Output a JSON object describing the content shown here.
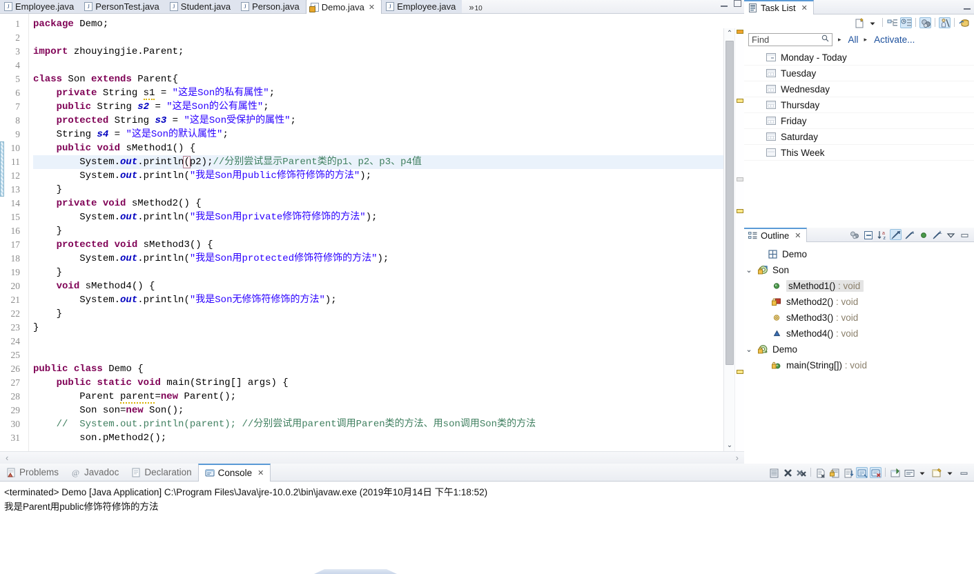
{
  "editor": {
    "tabs": [
      {
        "label": "Employee.java",
        "active": false,
        "warn": false
      },
      {
        "label": "PersonTest.java",
        "active": false,
        "warn": false
      },
      {
        "label": "Student.java",
        "active": false,
        "warn": false
      },
      {
        "label": "Person.java",
        "active": false,
        "warn": false
      },
      {
        "label": "Demo.java",
        "active": true,
        "warn": true
      },
      {
        "label": "Employee.java",
        "active": false,
        "warn": false
      }
    ],
    "overflow_chevron": "»",
    "overflow_count": "10",
    "close_glyph": "✕",
    "hscroll_left": "‹",
    "hscroll_right": "›",
    "scroll_up": "⌃",
    "scroll_down": "⌄",
    "lines": [
      {
        "n": "1",
        "tokens": [
          {
            "t": "package",
            "c": "kw"
          },
          {
            "t": " Demo;",
            "c": "plain"
          }
        ]
      },
      {
        "n": "2",
        "tokens": []
      },
      {
        "n": "3",
        "tokens": [
          {
            "t": "import",
            "c": "kw"
          },
          {
            "t": " zhouyingjie.Parent;",
            "c": "plain"
          }
        ]
      },
      {
        "n": "4",
        "tokens": []
      },
      {
        "n": "5",
        "tokens": [
          {
            "t": "class",
            "c": "kw"
          },
          {
            "t": " Son ",
            "c": "plain"
          },
          {
            "t": "extends",
            "c": "kw"
          },
          {
            "t": " Parent{",
            "c": "plain"
          }
        ]
      },
      {
        "n": "6",
        "warn": true,
        "tokens": [
          {
            "t": "    ",
            "c": "plain"
          },
          {
            "t": "private",
            "c": "kw"
          },
          {
            "t": " String ",
            "c": "plain"
          },
          {
            "t": "s1",
            "c": "plain",
            "sq": true
          },
          {
            "t": " = ",
            "c": "plain"
          },
          {
            "t": "\"这是Son的私有属性\"",
            "c": "str"
          },
          {
            "t": ";",
            "c": "plain"
          }
        ]
      },
      {
        "n": "7",
        "tokens": [
          {
            "t": "    ",
            "c": "plain"
          },
          {
            "t": "public",
            "c": "kw"
          },
          {
            "t": " String ",
            "c": "plain"
          },
          {
            "t": "s2",
            "c": "fld"
          },
          {
            "t": " = ",
            "c": "plain"
          },
          {
            "t": "\"这是Son的公有属性\"",
            "c": "str"
          },
          {
            "t": ";",
            "c": "plain"
          }
        ]
      },
      {
        "n": "8",
        "tokens": [
          {
            "t": "    ",
            "c": "plain"
          },
          {
            "t": "protected",
            "c": "kw"
          },
          {
            "t": " String ",
            "c": "plain"
          },
          {
            "t": "s3",
            "c": "fld"
          },
          {
            "t": " = ",
            "c": "plain"
          },
          {
            "t": "\"这是Son受保护的属性\"",
            "c": "str"
          },
          {
            "t": ";",
            "c": "plain"
          }
        ]
      },
      {
        "n": "9",
        "tokens": [
          {
            "t": "    String ",
            "c": "plain"
          },
          {
            "t": "s4",
            "c": "fld"
          },
          {
            "t": " = ",
            "c": "plain"
          },
          {
            "t": "\"这是Son的默认属性\"",
            "c": "str"
          },
          {
            "t": ";",
            "c": "plain"
          }
        ]
      },
      {
        "n": "10",
        "fold": true,
        "tokens": [
          {
            "t": "    ",
            "c": "plain"
          },
          {
            "t": "public",
            "c": "kw"
          },
          {
            "t": " ",
            "c": "plain"
          },
          {
            "t": "void",
            "c": "kw"
          },
          {
            "t": " sMethod1() {",
            "c": "plain"
          }
        ]
      },
      {
        "n": "11",
        "current": true,
        "tokens": [
          {
            "t": "        System.",
            "c": "plain"
          },
          {
            "t": "out",
            "c": "fld"
          },
          {
            "t": ".println",
            "c": "plain"
          },
          {
            "t": "(",
            "c": "plain",
            "brkt": true
          },
          {
            "t": "p2);",
            "c": "plain"
          },
          {
            "t": "//分别尝试显示Parent类的p1、p2、p3、p4值",
            "c": "cmt"
          }
        ]
      },
      {
        "n": "12",
        "tokens": [
          {
            "t": "        System.",
            "c": "plain"
          },
          {
            "t": "out",
            "c": "fld"
          },
          {
            "t": ".println(",
            "c": "plain"
          },
          {
            "t": "\"我是Son用public修饰符修饰的方法\"",
            "c": "str"
          },
          {
            "t": ");",
            "c": "plain"
          }
        ]
      },
      {
        "n": "13",
        "tokens": [
          {
            "t": "    }",
            "c": "plain"
          }
        ]
      },
      {
        "n": "14",
        "warn": true,
        "fold": true,
        "tokens": [
          {
            "t": "    ",
            "c": "plain"
          },
          {
            "t": "private",
            "c": "kw"
          },
          {
            "t": " ",
            "c": "plain"
          },
          {
            "t": "void",
            "c": "kw"
          },
          {
            "t": " sMethod2() {",
            "c": "plain"
          }
        ]
      },
      {
        "n": "15",
        "tokens": [
          {
            "t": "        System.",
            "c": "plain"
          },
          {
            "t": "out",
            "c": "fld"
          },
          {
            "t": ".println(",
            "c": "plain"
          },
          {
            "t": "\"我是Son用private修饰符修饰的方法\"",
            "c": "str"
          },
          {
            "t": ");",
            "c": "plain"
          }
        ]
      },
      {
        "n": "16",
        "tokens": [
          {
            "t": "    }",
            "c": "plain"
          }
        ]
      },
      {
        "n": "17",
        "fold": true,
        "tokens": [
          {
            "t": "    ",
            "c": "plain"
          },
          {
            "t": "protected",
            "c": "kw"
          },
          {
            "t": " ",
            "c": "plain"
          },
          {
            "t": "void",
            "c": "kw"
          },
          {
            "t": " sMethod3() {",
            "c": "plain"
          }
        ]
      },
      {
        "n": "18",
        "tokens": [
          {
            "t": "        System.",
            "c": "plain"
          },
          {
            "t": "out",
            "c": "fld"
          },
          {
            "t": ".println(",
            "c": "plain"
          },
          {
            "t": "\"我是Son用protected修饰符修饰的方法\"",
            "c": "str"
          },
          {
            "t": ");",
            "c": "plain"
          }
        ]
      },
      {
        "n": "19",
        "tokens": [
          {
            "t": "    }",
            "c": "plain"
          }
        ]
      },
      {
        "n": "20",
        "fold": true,
        "tokens": [
          {
            "t": "    ",
            "c": "plain"
          },
          {
            "t": "void",
            "c": "kw"
          },
          {
            "t": " sMethod4() {",
            "c": "plain"
          }
        ]
      },
      {
        "n": "21",
        "tokens": [
          {
            "t": "        System.",
            "c": "plain"
          },
          {
            "t": "out",
            "c": "fld"
          },
          {
            "t": ".println(",
            "c": "plain"
          },
          {
            "t": "\"我是Son无修饰符修饰的方法\"",
            "c": "str"
          },
          {
            "t": ");",
            "c": "plain"
          }
        ]
      },
      {
        "n": "22",
        "tokens": [
          {
            "t": "    }",
            "c": "plain"
          }
        ]
      },
      {
        "n": "23",
        "tokens": [
          {
            "t": "}",
            "c": "plain"
          }
        ]
      },
      {
        "n": "24",
        "tokens": []
      },
      {
        "n": "25",
        "tokens": []
      },
      {
        "n": "26",
        "tokens": [
          {
            "t": "public",
            "c": "kw"
          },
          {
            "t": " ",
            "c": "plain"
          },
          {
            "t": "class",
            "c": "kw"
          },
          {
            "t": " Demo {",
            "c": "plain"
          }
        ]
      },
      {
        "n": "27",
        "fold": true,
        "tokens": [
          {
            "t": "    ",
            "c": "plain"
          },
          {
            "t": "public",
            "c": "kw"
          },
          {
            "t": " ",
            "c": "plain"
          },
          {
            "t": "static",
            "c": "kw"
          },
          {
            "t": " ",
            "c": "plain"
          },
          {
            "t": "void",
            "c": "kw"
          },
          {
            "t": " main(String[] args) {",
            "c": "plain"
          }
        ]
      },
      {
        "n": "28",
        "warn": true,
        "tokens": [
          {
            "t": "        Parent ",
            "c": "plain"
          },
          {
            "t": "parent",
            "c": "plain",
            "sq": true
          },
          {
            "t": "=",
            "c": "plain"
          },
          {
            "t": "new",
            "c": "kw"
          },
          {
            "t": " Parent();",
            "c": "plain"
          }
        ]
      },
      {
        "n": "29",
        "tokens": [
          {
            "t": "        Son son=",
            "c": "plain"
          },
          {
            "t": "new",
            "c": "kw"
          },
          {
            "t": " Son();",
            "c": "plain"
          }
        ]
      },
      {
        "n": "30",
        "tokens": [
          {
            "t": "    //  System.out.println(parent); //分别尝试用parent调用Paren类的方法、用son调用Son类的方法",
            "c": "cmt"
          }
        ]
      },
      {
        "n": "31",
        "tokens": [
          {
            "t": "        son.pMethod2();",
            "c": "plain"
          }
        ]
      }
    ]
  },
  "tasklist": {
    "title": "Task List",
    "close_glyph": "✕",
    "find_placeholder": "Find",
    "find_value": "",
    "search_icon": "⚲",
    "all_label": "All",
    "activate_label": "Activate...",
    "caret": "▸",
    "items": [
      {
        "label": "Monday - Today",
        "kind": "today"
      },
      {
        "label": "Tuesday",
        "kind": "day"
      },
      {
        "label": "Wednesday",
        "kind": "day"
      },
      {
        "label": "Thursday",
        "kind": "day"
      },
      {
        "label": "Friday",
        "kind": "day"
      },
      {
        "label": "Saturday",
        "kind": "day"
      },
      {
        "label": "This Week",
        "kind": "week"
      }
    ]
  },
  "outline": {
    "title": "Outline",
    "close_glyph": "✕",
    "twisty_open": "⌄",
    "items": [
      {
        "label": "Demo",
        "type": "",
        "indent": 1,
        "twisty": "",
        "icon": "package-icon",
        "selected": false
      },
      {
        "label": "Son",
        "type": "",
        "indent": 0,
        "twisty": "⌄",
        "icon": "class-icon",
        "selected": false
      },
      {
        "label": "sMethod1()",
        "type": " : void",
        "indent": 2,
        "twisty": "",
        "icon": "method-public-icon",
        "selected": true
      },
      {
        "label": "sMethod2()",
        "type": " : void",
        "indent": 2,
        "twisty": "",
        "icon": "method-private-icon",
        "selected": false
      },
      {
        "label": "sMethod3()",
        "type": " : void",
        "indent": 2,
        "twisty": "",
        "icon": "method-protected-icon",
        "selected": false
      },
      {
        "label": "sMethod4()",
        "type": " : void",
        "indent": 2,
        "twisty": "",
        "icon": "method-default-icon",
        "selected": false
      },
      {
        "label": "Demo",
        "type": "",
        "indent": 0,
        "twisty": "⌄",
        "icon": "class-public-icon",
        "selected": false
      },
      {
        "label": "main(String[])",
        "type": " : void",
        "indent": 2,
        "twisty": "",
        "icon": "method-static-icon",
        "selected": false
      }
    ]
  },
  "bottom": {
    "tabs": [
      {
        "label": "Problems",
        "active": false,
        "icon": "problems-icon"
      },
      {
        "label": "Javadoc",
        "active": false,
        "icon": "javadoc-icon"
      },
      {
        "label": "Declaration",
        "active": false,
        "icon": "declaration-icon"
      },
      {
        "label": "Console",
        "active": true,
        "icon": "console-icon"
      }
    ],
    "close_glyph": "✕",
    "console_lines": [
      "<terminated> Demo [Java Application] C:\\Program Files\\Java\\jre-10.0.2\\bin\\javaw.exe (2019年10月14日 下午1:18:52)",
      "我是Parent用public修饰符修饰的方法"
    ]
  },
  "colors": {
    "accent": "#5a9ad6",
    "keyword": "#7f0055",
    "string": "#2a00ff",
    "comment": "#3f7f5f",
    "field": "#0000c0",
    "current_line": "#eaf2fb",
    "link": "#1b4f9c"
  }
}
